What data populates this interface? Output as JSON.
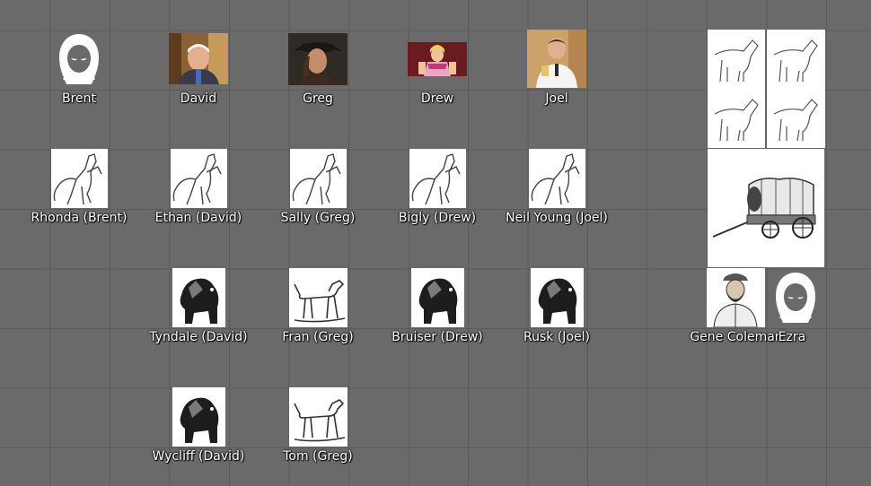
{
  "map": {
    "tokens": [
      {
        "id": "brent",
        "label": "Brent",
        "icon": "hooded-figure-icon"
      },
      {
        "id": "david",
        "label": "David",
        "icon": "portrait-older-man"
      },
      {
        "id": "greg",
        "label": "Greg",
        "icon": "portrait-tricorn-hat"
      },
      {
        "id": "drew",
        "label": "Drew",
        "icon": "portrait-blond-hero"
      },
      {
        "id": "joel",
        "label": "Joel",
        "icon": "portrait-man-with-drink"
      },
      {
        "id": "horses",
        "label": "",
        "icon": "horse-team-icon"
      },
      {
        "id": "rhonda",
        "label": "Rhonda (Brent)",
        "icon": "rearing-horse-icon"
      },
      {
        "id": "ethan",
        "label": "Ethan (David)",
        "icon": "rearing-horse-icon"
      },
      {
        "id": "sally",
        "label": "Sally (Greg)",
        "icon": "rearing-horse-icon"
      },
      {
        "id": "bigly",
        "label": "Bigly (Drew)",
        "icon": "rearing-horse-icon"
      },
      {
        "id": "neil",
        "label": "Neil Young (Joel)",
        "icon": "rearing-horse-icon"
      },
      {
        "id": "wagon",
        "label": "",
        "icon": "covered-wagon-icon"
      },
      {
        "id": "tyndale",
        "label": "Tyndale (David)",
        "icon": "mastiff-icon"
      },
      {
        "id": "fran",
        "label": "Fran (Greg)",
        "icon": "hound-icon"
      },
      {
        "id": "bruiser",
        "label": "Bruiser (Drew)",
        "icon": "mastiff-icon"
      },
      {
        "id": "rusk",
        "label": "Rusk (Joel)",
        "icon": "mastiff-icon"
      },
      {
        "id": "gene",
        "label": "Gene Coleman",
        "icon": "portrait-pioneer-man"
      },
      {
        "id": "ezra",
        "label": "Ezra",
        "icon": "hooded-figure-icon"
      },
      {
        "id": "wycliff",
        "label": "Wycliff (David)",
        "icon": "mastiff-icon"
      },
      {
        "id": "tom",
        "label": "Tom (Greg)",
        "icon": "hound-icon"
      }
    ]
  }
}
